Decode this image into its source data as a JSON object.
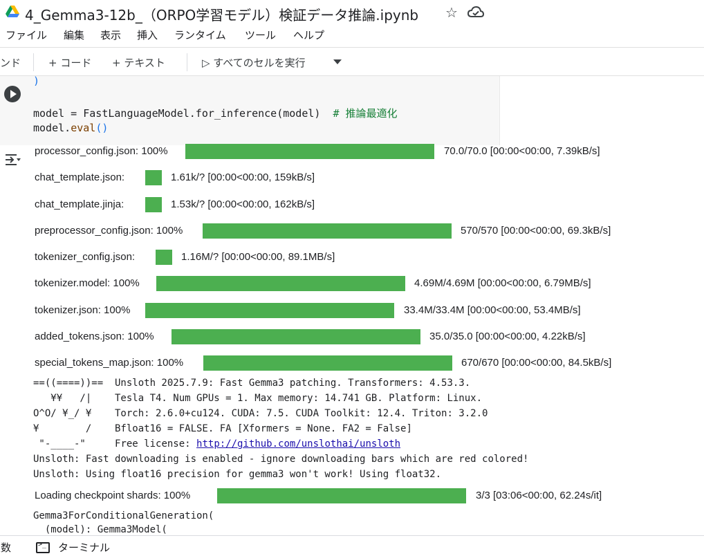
{
  "window": {
    "title": "4_Gemma3-12b_（ORPO学習モデル）検証データ推論.ipynb",
    "icons": [
      "drive-icon",
      "star-icon",
      "cloud-icon"
    ]
  },
  "menu": {
    "items": [
      "ファイル",
      "編集",
      "表示",
      "挿入",
      "ランタイム",
      "ツール",
      "ヘルプ"
    ]
  },
  "toolbar": {
    "cut_label": "ンド",
    "add_code": "+ コード",
    "add_text": "+ テキスト",
    "run_all": "▷ すべてのセルを実行"
  },
  "code": {
    "line0": ")",
    "line1_code": "model = FastLanguageModel.for_inference(model)",
    "line1_comment": "# 推論最適化",
    "line2_a": "model.",
    "line2_b": "eval",
    "line2_c": "()"
  },
  "progress": [
    {
      "label": "processor_config.json: 100%",
      "fraction": 1.0,
      "stats": "70.0/70.0  [00:00<00:00,  7.39kB/s]"
    },
    {
      "label": "chat_template.json:",
      "fraction": 1.0,
      "stats": "1.61k/? [00:00<00:00,  159kB/s]"
    },
    {
      "label": "chat_template.jinja:",
      "fraction": 1.0,
      "stats": "1.53k/? [00:00<00:00,  162kB/s]"
    },
    {
      "label": "preprocessor_config.json: 100%",
      "fraction": 1.0,
      "stats": "570/570  [00:00<00:00,  69.3kB/s]"
    },
    {
      "label": "tokenizer_config.json:",
      "fraction": 1.0,
      "stats": "1.16M/? [00:00<00:00,  89.1MB/s]"
    },
    {
      "label": "tokenizer.model: 100%",
      "fraction": 1.0,
      "stats": "4.69M/4.69M  [00:00<00:00,  6.79MB/s]"
    },
    {
      "label": "tokenizer.json: 100%",
      "fraction": 1.0,
      "stats": "33.4M/33.4M  [00:00<00:00,  53.4MB/s]"
    },
    {
      "label": "added_tokens.json: 100%",
      "fraction": 1.0,
      "stats": "35.0/35.0  [00:00<00:00,  4.22kB/s]"
    },
    {
      "label": "special_tokens_map.json: 100%",
      "fraction": 1.0,
      "stats": "670/670  [00:00<00:00,  84.5kB/s]"
    }
  ],
  "unsloth_banner": [
    "==((====))==  Unsloth 2025.7.9: Fast Gemma3 patching. Transformers: 4.53.3.",
    "   ¥¥   /|    Tesla T4. Num GPUs = 1. Max memory: 14.741 GB. Platform: Linux.",
    "O^O/ ¥_/ ¥    Torch: 2.6.0+cu124. CUDA: 7.5. CUDA Toolkit: 12.4. Triton: 3.2.0",
    "¥        /    Bfloat16 = FALSE. FA [Xformers = None. FA2 = False]",
    " \"-____-\"     "
  ],
  "license_prefix": "Free license: ",
  "license_url": "http://github.com/unslothai/unsloth",
  "unsloth_msgs": [
    "Unsloth: Fast downloading is enabled - ignore downloading bars which are red colored!",
    "Unsloth: Using float16 precision for gemma3 won't work! Using float32."
  ],
  "checkpoint": {
    "label": "Loading checkpoint shards: 100%",
    "fraction": 1.0,
    "stats": "3/3  [03:06<00:00,  62.24s/it]"
  },
  "model_repr": [
    "Gemma3ForConditionalGeneration(",
    "  (model): Gemma3Model("
  ],
  "bottom": {
    "vars_label": "変数",
    "terminal_label": "ターミナル"
  },
  "colors": {
    "progress_fill": "#4caf50",
    "link": "#1a0dab"
  }
}
